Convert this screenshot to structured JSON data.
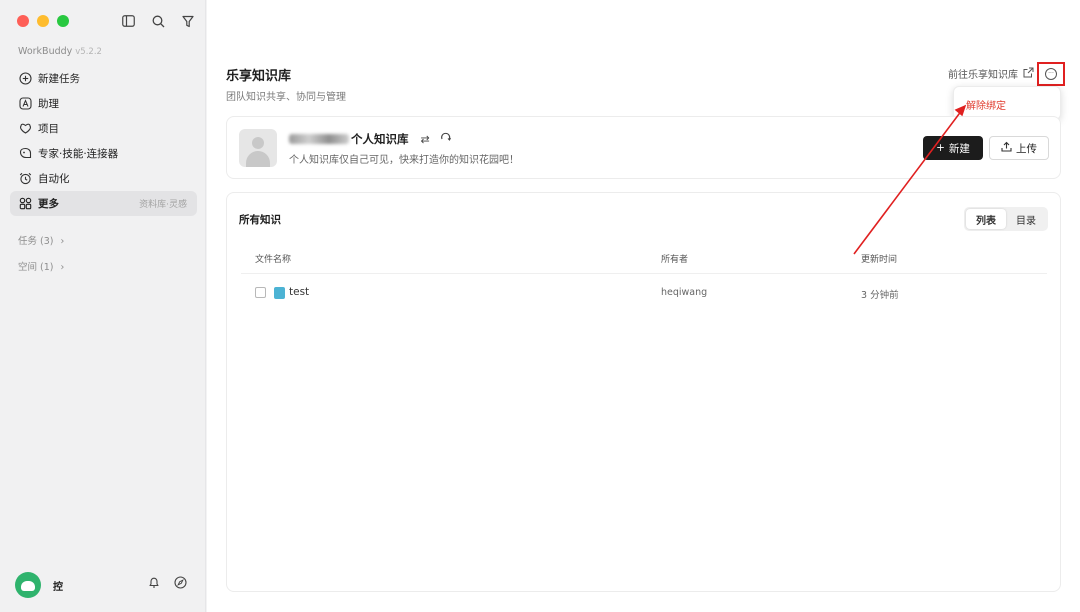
{
  "app": {
    "brand": "WorkBuddy",
    "version": "v5.2.2"
  },
  "sidebar": {
    "items": [
      {
        "label": "新建任务",
        "icon": "plus-circle-icon"
      },
      {
        "label": "助理",
        "icon": "assistant-icon"
      },
      {
        "label": "项目",
        "icon": "project-icon"
      },
      {
        "label": "专家·技能·连接器",
        "icon": "expert-icon"
      },
      {
        "label": "自动化",
        "icon": "alarm-clock-icon"
      },
      {
        "label": "更多",
        "icon": "grid-icon",
        "hint": "资料库·灵感",
        "active": true
      }
    ],
    "sections": {
      "tasks": "任务 (3)",
      "spaces": "空间 (1)"
    },
    "user": {
      "name": "控"
    }
  },
  "header": {
    "title": "乐享知识库",
    "subtitle": "团队知识共享、协同与管理",
    "goto_label": "前往乐享知识库",
    "menu": {
      "unbind": "解除绑定"
    }
  },
  "kb": {
    "name_suffix": "个人知识库",
    "description": "个人知识库仅自己可见，快来打造你的知识花园吧！",
    "new_label": "新建",
    "upload_label": "上传"
  },
  "list": {
    "title": "所有知识",
    "views": [
      "列表",
      "目录"
    ],
    "active_view": "列表",
    "columns": {
      "name": "文件名称",
      "owner": "所有者",
      "updated": "更新时间"
    },
    "rows": [
      {
        "name": "test",
        "owner": "heqiwang",
        "updated": "3 分钟前"
      }
    ]
  },
  "colors": {
    "annotation_red": "#e02020",
    "danger_text": "#e03b2e",
    "primary_button": "#1c1c1c"
  }
}
